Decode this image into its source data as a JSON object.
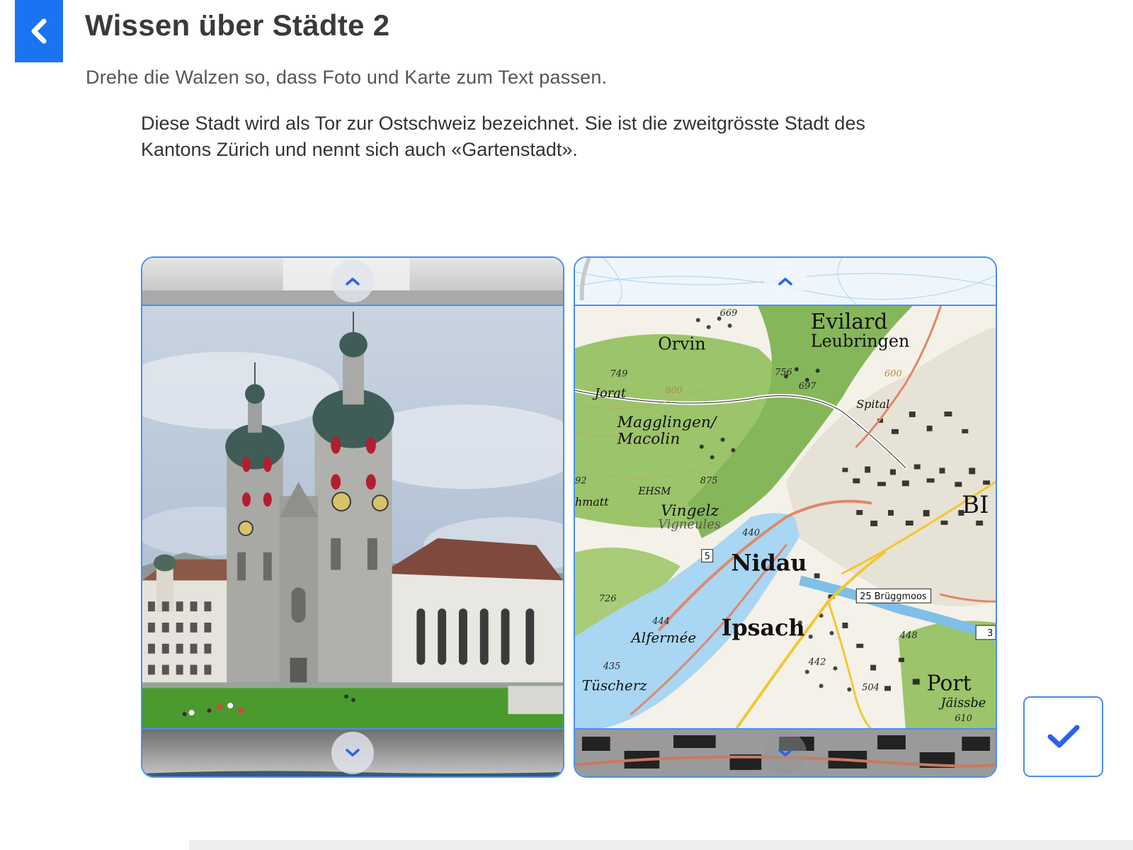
{
  "header": {
    "back_icon": "chevron-left-icon",
    "title": "Wissen über Städte 2",
    "subtitle": "Drehe die Walzen so, dass Foto und Karte zum Text passen."
  },
  "question": {
    "text": "Diese Stadt wird als Tor zur Ostschweiz bezeichnet. Sie ist die zweitgrösste Stadt des Kantons Zürich und nennt sich auch «Gartenstadt»."
  },
  "reels": {
    "photo": {
      "up_icon": "chevron-up-icon",
      "down_icon": "chevron-down-icon",
      "image": "cathedral-photo"
    },
    "map": {
      "up_icon": "chevron-up-icon",
      "down_icon": "chevron-down-icon",
      "image": "topographic-map",
      "labels": {
        "evilard": "Evilard",
        "leubringen": "Leubringen",
        "orvin": "Orvin",
        "jorat": "Jorat",
        "magglingen": "Magglingen/",
        "macolin": "Macolin",
        "ehsm": "EHSM",
        "vingelz": "Vingelz",
        "vigneules": "Vigneules",
        "nidau": "Nidau",
        "ipsach": "Ipsach",
        "alfermee": "Alfermée",
        "tuscherz": "Tüscherz",
        "port": "Port",
        "jaissberg": "Jäissbe",
        "bi": "BI",
        "spital": "Spital",
        "bruggmoos": "25 Brüggmoos",
        "exit3": "3",
        "road5": "5",
        "hmatt": "hmatt",
        "h669": "669",
        "h749": "749",
        "h756": "756",
        "h697": "697",
        "h875": "875",
        "h440": "440",
        "h726": "726",
        "h444": "444",
        "h435": "435",
        "h442": "442",
        "h504": "504",
        "h448": "448",
        "h610": "610",
        "h800": "800",
        "h600": "600",
        "h92": "92"
      }
    }
  },
  "actions": {
    "check_icon": "checkmark-icon"
  }
}
